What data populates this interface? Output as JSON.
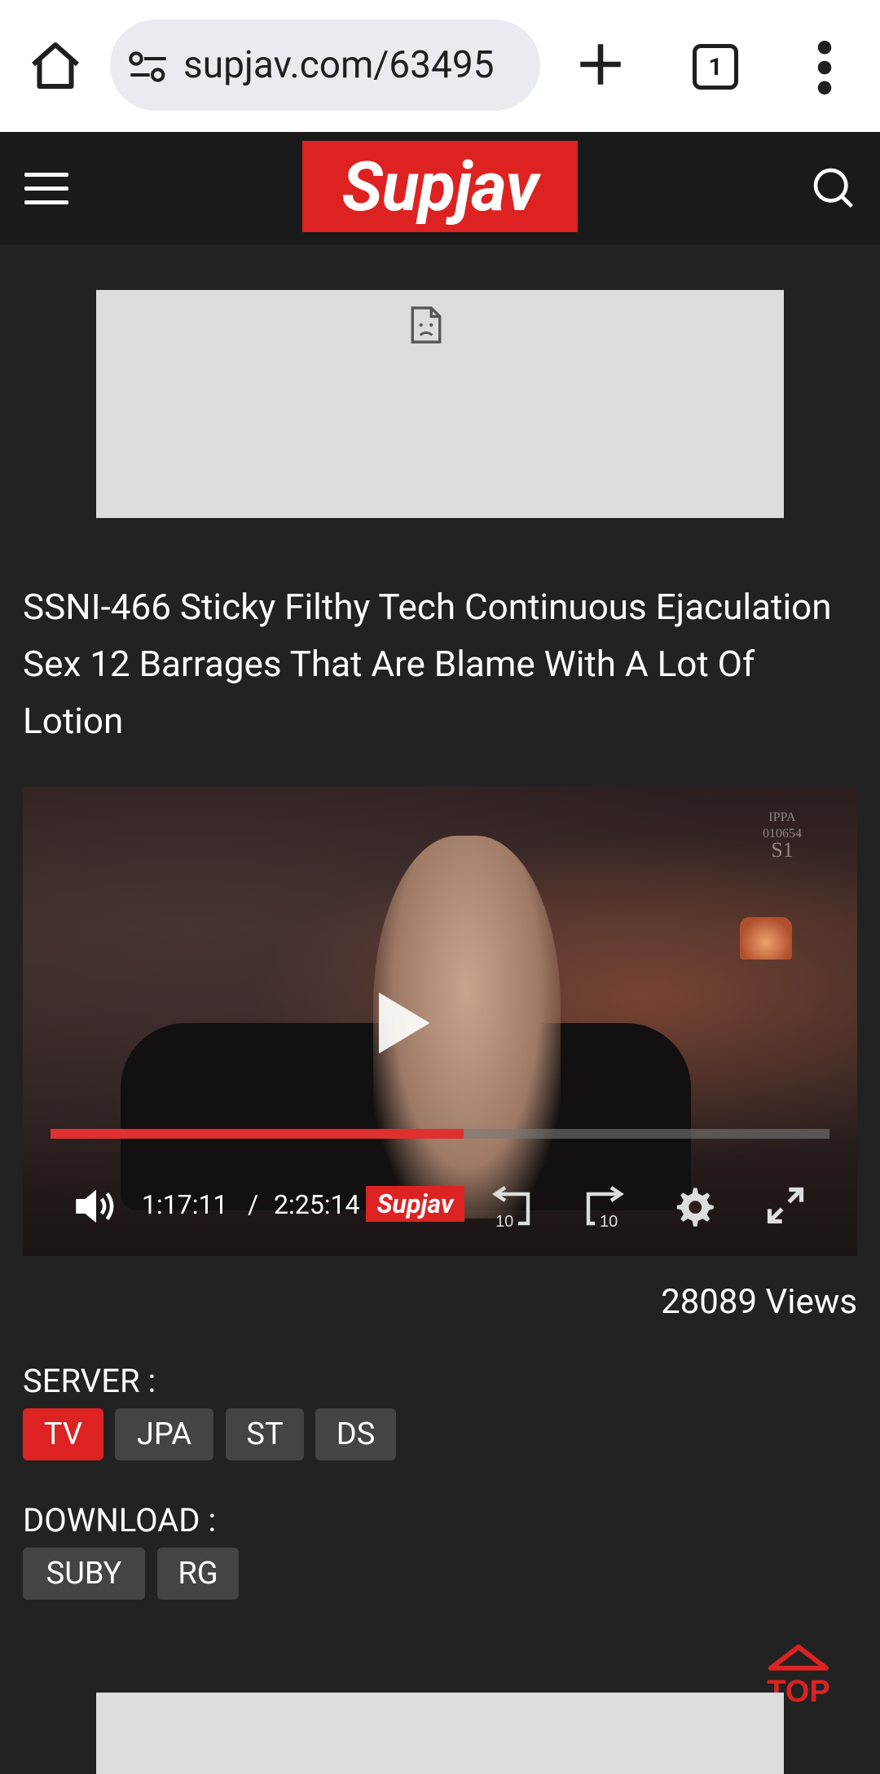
{
  "browser": {
    "url": "supjav.com/63495",
    "tab_count": "1"
  },
  "header": {
    "logo_text": "Supjav"
  },
  "video": {
    "title": "SSNI-466 Sticky Filthy Tech Continuous Ejaculation Sex 12 Barrages That Are Blame With A Lot Of Lotion",
    "current_time": "1:17:11",
    "time_separator": "/",
    "duration": "2:25:14",
    "progress_fraction": 0.53,
    "player_logo": "Supjav",
    "rewind_label": "10",
    "forward_label": "10",
    "views": "28089 Views"
  },
  "server": {
    "label": "SERVER :",
    "options": [
      "TV",
      "JPA",
      "ST",
      "DS"
    ],
    "selected": "TV"
  },
  "download": {
    "label": "DOWNLOAD :",
    "options": [
      "SUBY",
      "RG"
    ]
  },
  "scroll_top": {
    "label": "TOP"
  },
  "colors": {
    "accent": "#dd2222",
    "background": "#222222",
    "header_bg": "#1a1a1a",
    "button_bg": "#444444"
  }
}
